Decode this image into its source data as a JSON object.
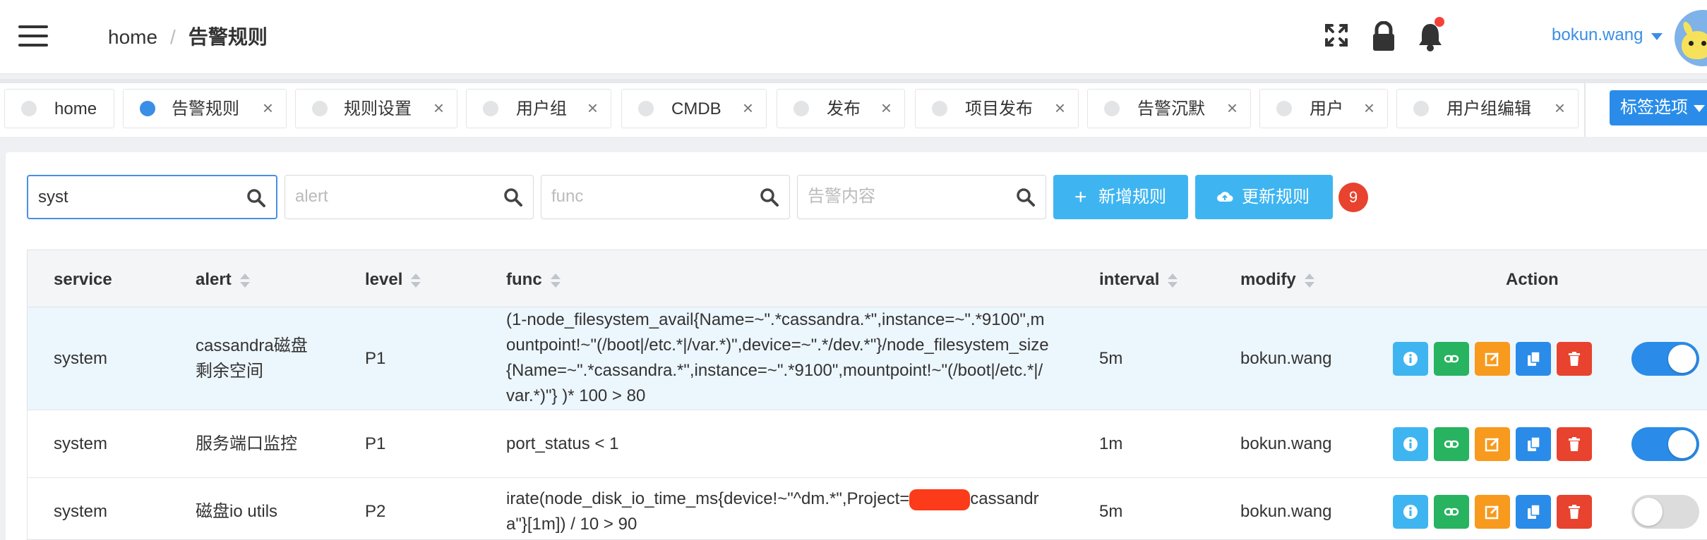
{
  "breadcrumb": {
    "home": "home",
    "separator": "/",
    "current": "告警规则"
  },
  "user": {
    "name": "bokun.wang"
  },
  "tabs": [
    {
      "label": "home",
      "active": false,
      "closable": false
    },
    {
      "label": "告警规则",
      "active": true,
      "closable": true
    },
    {
      "label": "规则设置",
      "active": false,
      "closable": true
    },
    {
      "label": "用户组",
      "active": false,
      "closable": true
    },
    {
      "label": "CMDB",
      "active": false,
      "closable": true
    },
    {
      "label": "发布",
      "active": false,
      "closable": true
    },
    {
      "label": "项目发布",
      "active": false,
      "closable": true
    },
    {
      "label": "告警沉默",
      "active": false,
      "closable": true
    },
    {
      "label": "用户",
      "active": false,
      "closable": true
    },
    {
      "label": "用户组编辑",
      "active": false,
      "closable": true
    }
  ],
  "tab_close_glyph": "×",
  "tab_options_label": "标签选项",
  "filters": {
    "service": {
      "value": "syst",
      "placeholder": ""
    },
    "alert": {
      "value": "",
      "placeholder": "alert"
    },
    "func": {
      "value": "",
      "placeholder": "func"
    },
    "content": {
      "value": "",
      "placeholder": "告警内容"
    }
  },
  "buttons": {
    "add": "新增规则",
    "update": "更新规则",
    "add_icon": "+"
  },
  "pending_count": "9",
  "table": {
    "columns": {
      "service": "service",
      "alert": "alert",
      "level": "level",
      "func": "func",
      "interval": "interval",
      "modify": "modify",
      "action": "Action"
    },
    "rows": [
      {
        "service": "system",
        "alert": "cassandra磁盘剩余空间",
        "level": "P1",
        "func": "(1-node_filesystem_avail{Name=~\".*cassandra.*\",instance=~\".*9100\",mountpoint!~\"(/boot|/etc.*|/var.*)\",device=~\".*/dev.*\"}/node_filesystem_size{Name=~\".*cassandra.*\",instance=~\".*9100\",mountpoint!~\"(/boot|/etc.*|/var.*)\"} )* 100 > 80",
        "interval": "5m",
        "modify": "bokun.wang",
        "enabled": true
      },
      {
        "service": "system",
        "alert": "服务端口监控",
        "level": "P1",
        "func": "port_status < 1",
        "interval": "1m",
        "modify": "bokun.wang",
        "enabled": true
      },
      {
        "service": "system",
        "alert": "磁盘io utils",
        "level": "P2",
        "func_before": "irate(node_disk_io_time_ms{device!~\"^dm.*\",Project=",
        "func_after": "cassandra\"}[1m]) / 10 > 90",
        "interval": "5m",
        "modify": "bokun.wang",
        "enabled": false
      }
    ]
  },
  "colors": {
    "primary": "#2a8ce8",
    "info": "#3eb5f1",
    "success": "#27b35f",
    "warning": "#f79a1d",
    "danger": "#e8432e"
  }
}
